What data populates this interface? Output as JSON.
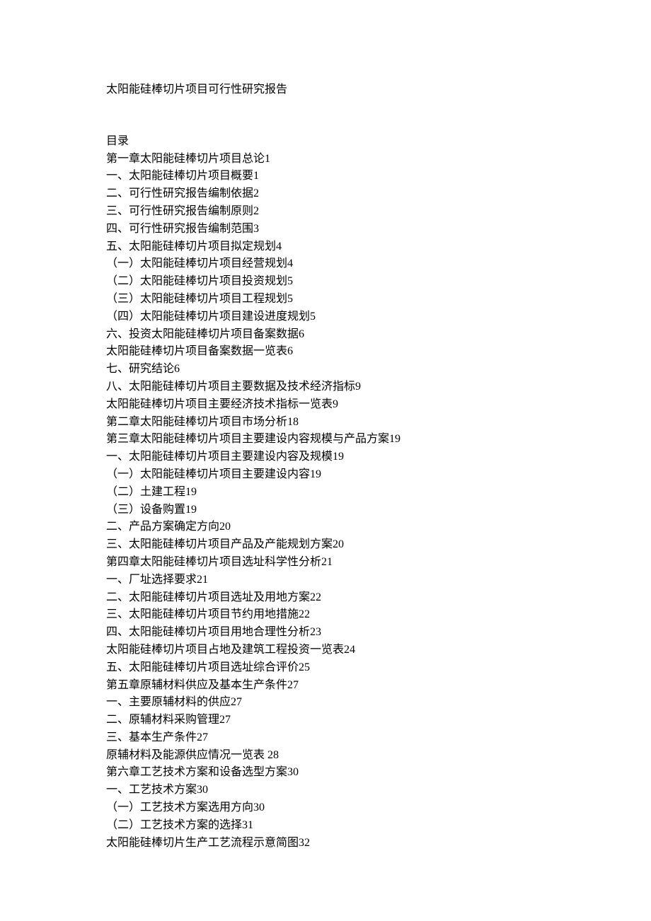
{
  "title": "太阳能硅棒切片项目可行性研究报告",
  "toc_heading": "目录",
  "toc": [
    {
      "text": "第一章太阳能硅棒切片项目总论",
      "page": "1"
    },
    {
      "text": "一、太阳能硅棒切片项目概要",
      "page": "1"
    },
    {
      "text": "二、可行性研究报告编制依据",
      "page": "2"
    },
    {
      "text": "三、可行性研究报告编制原则",
      "page": "2"
    },
    {
      "text": "四、可行性研究报告编制范围",
      "page": "3"
    },
    {
      "text": "五、太阳能硅棒切片项目拟定规划",
      "page": "4"
    },
    {
      "text": "（一）太阳能硅棒切片项目经营规划",
      "page": "4"
    },
    {
      "text": "（二）太阳能硅棒切片项目投资规划",
      "page": "5"
    },
    {
      "text": "（三）太阳能硅棒切片项目工程规划",
      "page": "5"
    },
    {
      "text": "（四）太阳能硅棒切片项目建设进度规划",
      "page": "5"
    },
    {
      "text": "六、投资太阳能硅棒切片项目备案数据",
      "page": "6"
    },
    {
      "text": "太阳能硅棒切片项目备案数据一览表",
      "page": "6"
    },
    {
      "text": "七、研究结论",
      "page": "6"
    },
    {
      "text": "八、太阳能硅棒切片项目主要数据及技术经济指标",
      "page": "9"
    },
    {
      "text": "太阳能硅棒切片项目主要经济技术指标一览表",
      "page": "9"
    },
    {
      "text": "第二章太阳能硅棒切片项目市场分析",
      "page": "18"
    },
    {
      "text": "第三章太阳能硅棒切片项目主要建设内容规模与产品方案",
      "page": "19"
    },
    {
      "text": "一、太阳能硅棒切片项目主要建设内容及规模",
      "page": "19"
    },
    {
      "text": "（一）太阳能硅棒切片项目主要建设内容",
      "page": "19"
    },
    {
      "text": "（二）土建工程",
      "page": "19"
    },
    {
      "text": "（三）设备购置",
      "page": "19"
    },
    {
      "text": "二、产品方案确定方向",
      "page": "20"
    },
    {
      "text": "三、太阳能硅棒切片项目产品及产能规划方案",
      "page": "20"
    },
    {
      "text": "第四章太阳能硅棒切片项目选址科学性分析",
      "page": "21"
    },
    {
      "text": "一、厂址选择要求",
      "page": "21"
    },
    {
      "text": "二、太阳能硅棒切片项目选址及用地方案",
      "page": "22"
    },
    {
      "text": "三、太阳能硅棒切片项目节约用地措施",
      "page": "22"
    },
    {
      "text": "四、太阳能硅棒切片项目用地合理性分析",
      "page": "23"
    },
    {
      "text": "太阳能硅棒切片项目占地及建筑工程投资一览表",
      "page": "24"
    },
    {
      "text": "五、太阳能硅棒切片项目选址综合评价",
      "page": "25"
    },
    {
      "text": "第五章原辅材料供应及基本生产条件",
      "page": "27"
    },
    {
      "text": "一、主要原辅材料的供应",
      "page": "27"
    },
    {
      "text": "二、原辅材料采购管理",
      "page": "27"
    },
    {
      "text": "三、基本生产条件",
      "page": "27"
    },
    {
      "text": "原辅材料及能源供应情况一览表 ",
      "page": "28"
    },
    {
      "text": "第六章工艺技术方案和设备选型方案",
      "page": "30"
    },
    {
      "text": "一、工艺技术方案",
      "page": "30"
    },
    {
      "text": "（一）工艺技术方案选用方向",
      "page": "30"
    },
    {
      "text": "（二）工艺技术方案的选择",
      "page": "31"
    },
    {
      "text": "太阳能硅棒切片生产工艺流程示意简图",
      "page": "32"
    }
  ]
}
